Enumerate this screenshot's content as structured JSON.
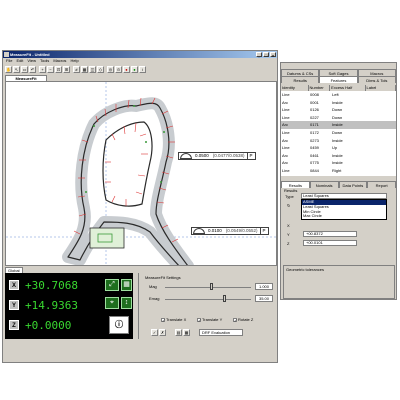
{
  "app": {
    "title": "MeasureFit - Untitled"
  },
  "window_buttons": [
    "_",
    "□",
    "×"
  ],
  "menu": [
    "File",
    "Edit",
    "View",
    "Tools",
    "Macros",
    "Help"
  ],
  "toolbar_icons": [
    "hand-icon",
    "arrow-icon",
    "box-select-icon",
    "undo-icon",
    "zoom-in-icon",
    "zoom-out-icon",
    "zoom-fit-icon",
    "zoom-window-icon",
    "grid-icon",
    "chart-icon",
    "fit-icon",
    "shape-icon",
    "target-icon",
    "target-icon",
    "stop-icon",
    "go-icon",
    "info-icon"
  ],
  "document_tab": "MeasureFit",
  "callouts": [
    {
      "value": "0.0500",
      "ref": "(0.0477/0.0538)",
      "flag": "P"
    },
    {
      "value": "0.0100",
      "ref": "(0.0549/0.0552)",
      "flag": "P"
    }
  ],
  "bottom_tabs": [
    "Global"
  ],
  "dro": {
    "axes": [
      {
        "axis": "X",
        "value": "+30.7068"
      },
      {
        "axis": "Y",
        "value": "+14.9363"
      },
      {
        "axis": "Z",
        "value": "+0.0000"
      }
    ]
  },
  "settings": {
    "header": "MeasureFit Settings",
    "mag": {
      "label": "Mag",
      "value": "1.000",
      "level": 0.52
    },
    "emag": {
      "label": "Emag",
      "value": "35.00",
      "level": 0.68
    },
    "checks": [
      {
        "label": "Translate X",
        "checked": true
      },
      {
        "label": "Translate Y",
        "checked": true
      },
      {
        "label": "Rotate Z",
        "checked": true
      }
    ],
    "eval_value": "DRF Evaluation"
  },
  "right_panel": {
    "tabs_row1": [
      "Datums & CSs",
      "Soft Gages",
      "Macros"
    ],
    "tabs_row2": [
      "Results",
      "Features",
      "Dims & Tols"
    ],
    "active_tab": "Features",
    "columns": [
      "Identity",
      "Number",
      "Excess Half",
      "Label"
    ],
    "features": [
      {
        "type": "Line",
        "number": "0008",
        "dir": "Left"
      },
      {
        "type": "Arc",
        "number": "0001",
        "dir": "Inside"
      },
      {
        "type": "Line",
        "number": "0126",
        "dir": "Down"
      },
      {
        "type": "Line",
        "number": "0227",
        "dir": "Down"
      },
      {
        "type": "Arc",
        "number": "0171",
        "dir": "Inside",
        "selected": true
      },
      {
        "type": "Line",
        "number": "0172",
        "dir": "Down"
      },
      {
        "type": "Arc",
        "number": "0273",
        "dir": "Inside"
      },
      {
        "type": "Line",
        "number": "0459",
        "dir": "Up"
      },
      {
        "type": "Arc",
        "number": "0461",
        "dir": "Inside"
      },
      {
        "type": "Arc",
        "number": "0775",
        "dir": "Inside"
      },
      {
        "type": "Line",
        "number": "0844",
        "dir": "Right"
      }
    ],
    "result_tabs": [
      "Results",
      "Nominals",
      "Data Points",
      "Report"
    ],
    "results_label": "Results",
    "type_label": "Type",
    "type_value": "Least Squares",
    "type_options": [
      "ASME",
      "Least Squares",
      "Min Circle",
      "Max Circle"
    ],
    "type_highlight": 0,
    "results": [
      {
        "label": "X",
        "value": ""
      },
      {
        "label": "Y",
        "value": "+00.8372"
      },
      {
        "label": "Z",
        "value": "+00.0101"
      }
    ],
    "tolerances_label": "Geometric tolerances"
  }
}
